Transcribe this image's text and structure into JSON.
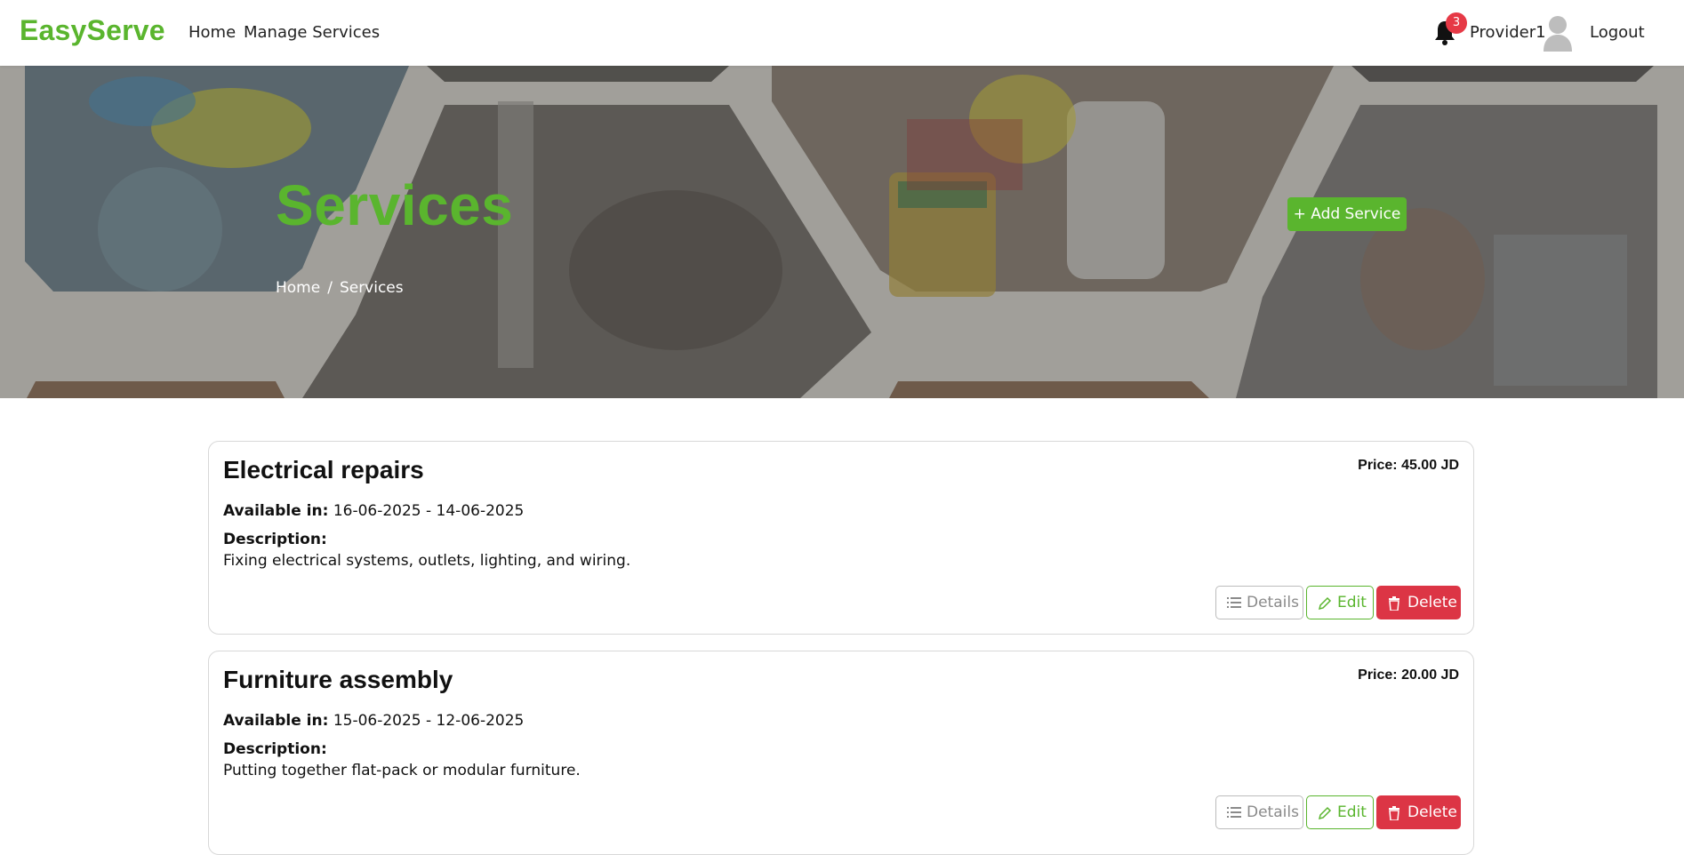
{
  "navbar": {
    "brand": "EasyServe",
    "links": [
      "Home",
      "Manage Services"
    ],
    "notification_count": "3",
    "user_name": "Provider1",
    "logout_label": "Logout"
  },
  "hero": {
    "title": "Services",
    "breadcrumb": [
      "Home",
      "Services"
    ],
    "breadcrumb_separator": "/",
    "add_button_label": "+ Add Service"
  },
  "services": [
    {
      "title": "Electrical repairs",
      "price_label": "Price:",
      "price_value": "45.00 JD",
      "available_label": "Available in:",
      "available_value": "16-06-2025 - 14-06-2025",
      "description_label": "Description:",
      "description": "Fixing electrical systems, outlets, lighting, and wiring.",
      "details_label": "Details",
      "edit_label": "Edit",
      "delete_label": "Delete"
    },
    {
      "title": "Furniture assembly",
      "price_label": "Price:",
      "price_value": "20.00 JD",
      "available_label": "Available in:",
      "available_value": "15-06-2025 - 12-06-2025",
      "description_label": "Description:",
      "description": "Putting together flat-pack or modular furniture.",
      "details_label": "Details",
      "edit_label": "Edit",
      "delete_label": "Delete"
    }
  ],
  "colors": {
    "brand_green": "#5ab52e",
    "danger_red": "#dc3545",
    "badge_red": "#e63946"
  },
  "icons": [
    "bell-icon",
    "user-avatar-icon",
    "list-icon",
    "pencil-icon",
    "trash-icon"
  ]
}
